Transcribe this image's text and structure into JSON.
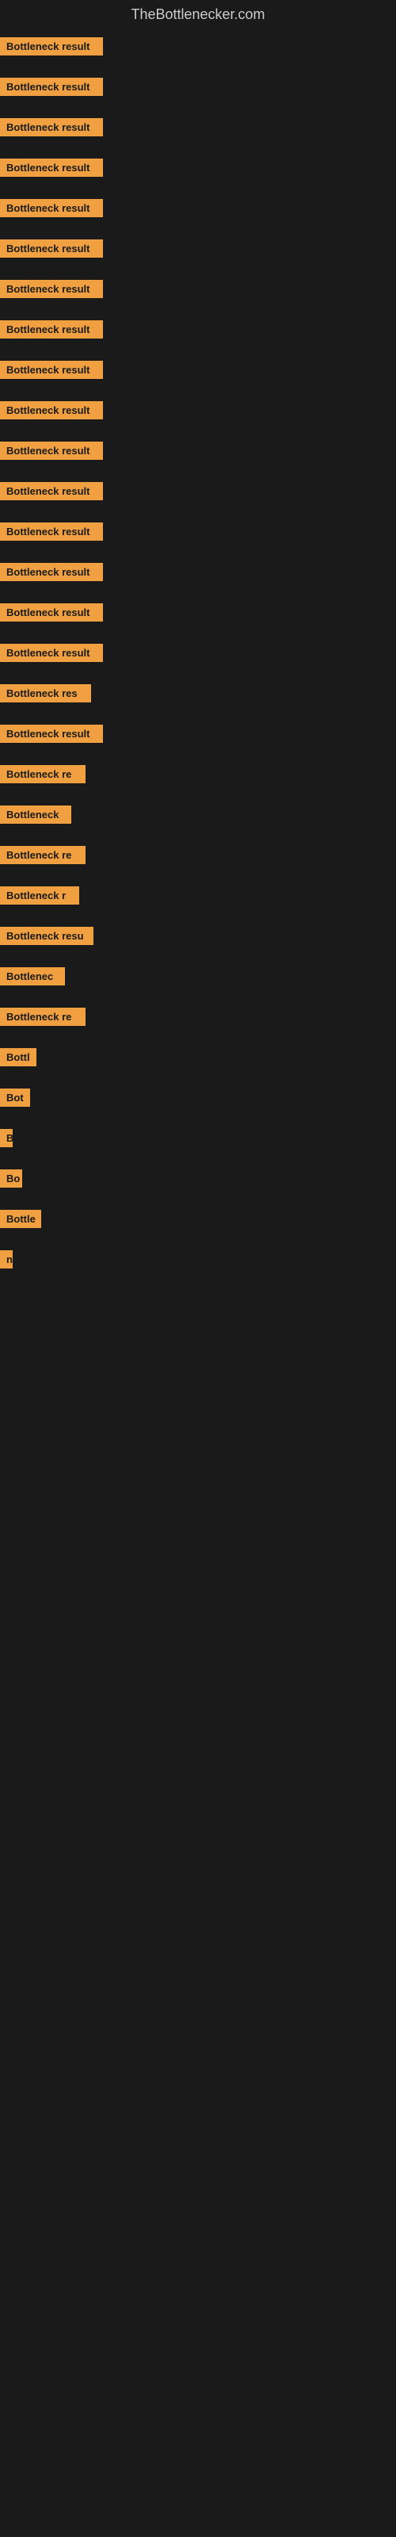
{
  "site_title": "TheBottlenecker.com",
  "bars": [
    {
      "label": "Bottleneck result",
      "width": 130,
      "top_padding": 8
    },
    {
      "label": "Bottleneck result",
      "width": 130,
      "top_padding": 20
    },
    {
      "label": "Bottleneck result",
      "width": 130,
      "top_padding": 20
    },
    {
      "label": "Bottleneck result",
      "width": 130,
      "top_padding": 20
    },
    {
      "label": "Bottleneck result",
      "width": 130,
      "top_padding": 20
    },
    {
      "label": "Bottleneck result",
      "width": 130,
      "top_padding": 20
    },
    {
      "label": "Bottleneck result",
      "width": 130,
      "top_padding": 20
    },
    {
      "label": "Bottleneck result",
      "width": 130,
      "top_padding": 20
    },
    {
      "label": "Bottleneck result",
      "width": 130,
      "top_padding": 20
    },
    {
      "label": "Bottleneck result",
      "width": 130,
      "top_padding": 20
    },
    {
      "label": "Bottleneck result",
      "width": 130,
      "top_padding": 20
    },
    {
      "label": "Bottleneck result",
      "width": 130,
      "top_padding": 20
    },
    {
      "label": "Bottleneck result",
      "width": 130,
      "top_padding": 20
    },
    {
      "label": "Bottleneck result",
      "width": 130,
      "top_padding": 20
    },
    {
      "label": "Bottleneck result",
      "width": 130,
      "top_padding": 20
    },
    {
      "label": "Bottleneck result",
      "width": 130,
      "top_padding": 20
    },
    {
      "label": "Bottleneck res",
      "width": 115,
      "top_padding": 20
    },
    {
      "label": "Bottleneck result",
      "width": 130,
      "top_padding": 20
    },
    {
      "label": "Bottleneck re",
      "width": 108,
      "top_padding": 20
    },
    {
      "label": "Bottleneck",
      "width": 90,
      "top_padding": 20
    },
    {
      "label": "Bottleneck re",
      "width": 108,
      "top_padding": 20
    },
    {
      "label": "Bottleneck r",
      "width": 100,
      "top_padding": 20
    },
    {
      "label": "Bottleneck resu",
      "width": 118,
      "top_padding": 20
    },
    {
      "label": "Bottlenec",
      "width": 82,
      "top_padding": 20
    },
    {
      "label": "Bottleneck re",
      "width": 108,
      "top_padding": 20
    },
    {
      "label": "Bottl",
      "width": 46,
      "top_padding": 20
    },
    {
      "label": "Bot",
      "width": 38,
      "top_padding": 20
    },
    {
      "label": "B",
      "width": 16,
      "top_padding": 20
    },
    {
      "label": "Bo",
      "width": 28,
      "top_padding": 20
    },
    {
      "label": "Bottle",
      "width": 52,
      "top_padding": 20
    },
    {
      "label": "n",
      "width": 12,
      "top_padding": 20
    }
  ]
}
